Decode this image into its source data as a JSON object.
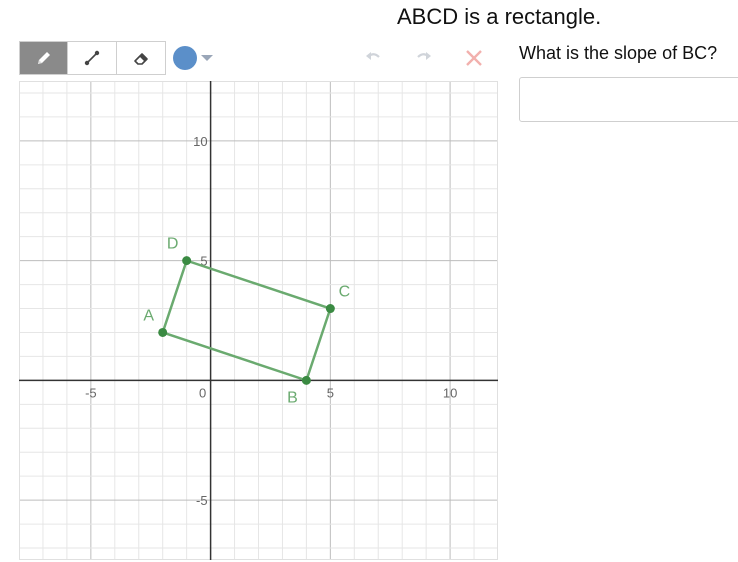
{
  "prompt": {
    "title": "ABCD is a rectangle.",
    "question": "What is the slope of BC?",
    "answer_value": ""
  },
  "toolbar": {
    "tools": [
      {
        "name": "pencil-icon",
        "active": true
      },
      {
        "name": "line-icon",
        "active": false
      },
      {
        "name": "eraser-icon",
        "active": false
      }
    ],
    "color": "#5b8fc9",
    "undo_icon": "undo-icon",
    "redo_icon": "redo-icon",
    "clear_icon": "close-icon"
  },
  "graph": {
    "x_range": [
      -8,
      12
    ],
    "y_range": [
      -7.5,
      12.5
    ],
    "minor_step": 1,
    "major_step": 5,
    "x_tick_labels": [
      "-5",
      "0",
      "5",
      "10"
    ],
    "y_tick_labels": [
      "-5",
      "5",
      "10"
    ],
    "shape_color": "#6aaa6f",
    "point_color": "#3a8a42",
    "label_color": "#6aaa6f",
    "points": [
      {
        "label": "A",
        "x": -2,
        "y": 2
      },
      {
        "label": "B",
        "x": 4,
        "y": 0
      },
      {
        "label": "C",
        "x": 5,
        "y": 3
      },
      {
        "label": "D",
        "x": -1,
        "y": 5
      }
    ]
  }
}
